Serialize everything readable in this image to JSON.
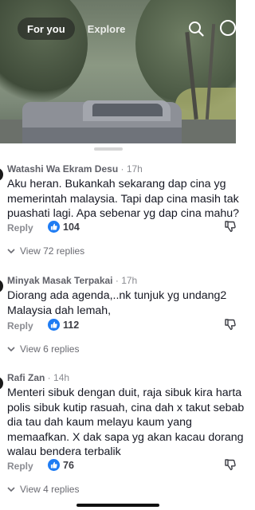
{
  "header": {
    "tabs": [
      {
        "label": "For you",
        "active": true
      },
      {
        "label": "Explore",
        "active": false
      }
    ],
    "icons": [
      "search-icon",
      "more-icon"
    ]
  },
  "comments": [
    {
      "author": "Watashi Wa Ekram Desu",
      "time": "17h",
      "lines": [
        "Aku heran. Bukankah sekarang dap cina yg",
        "memerintah malaysia. Tapi dap cina masih tak",
        "puashati lagi. Apa sebenar yg dap cina mahu?"
      ],
      "reply_label": "Reply",
      "likes": "104",
      "view_replies": "View 72 replies"
    },
    {
      "author": "Minyak Masak Terpakai",
      "time": "17h",
      "lines": [
        "Diorang ada agenda,..nk tunjuk yg undang2",
        "Malaysia dah lemah,"
      ],
      "reply_label": "Reply",
      "likes": "112",
      "view_replies": "View 6 replies"
    },
    {
      "author": "Rafi Zan",
      "time": "14h",
      "lines": [
        "Menteri sibuk dengan duit, raja sibuk kira harta",
        "polis sibuk kutip rasuah, cina dah x takut sebab",
        "dia tau dah kaum melayu kaum yang",
        "memaafkan. X dak sapa yg akan kacau dorang",
        "walau bendera terbalik"
      ],
      "reply_label": "Reply",
      "likes": "76",
      "view_replies": "View 4 replies"
    }
  ],
  "colors": {
    "like_blue": "#1f7cf3",
    "text": "#161823",
    "muted": "#8a8b91"
  }
}
